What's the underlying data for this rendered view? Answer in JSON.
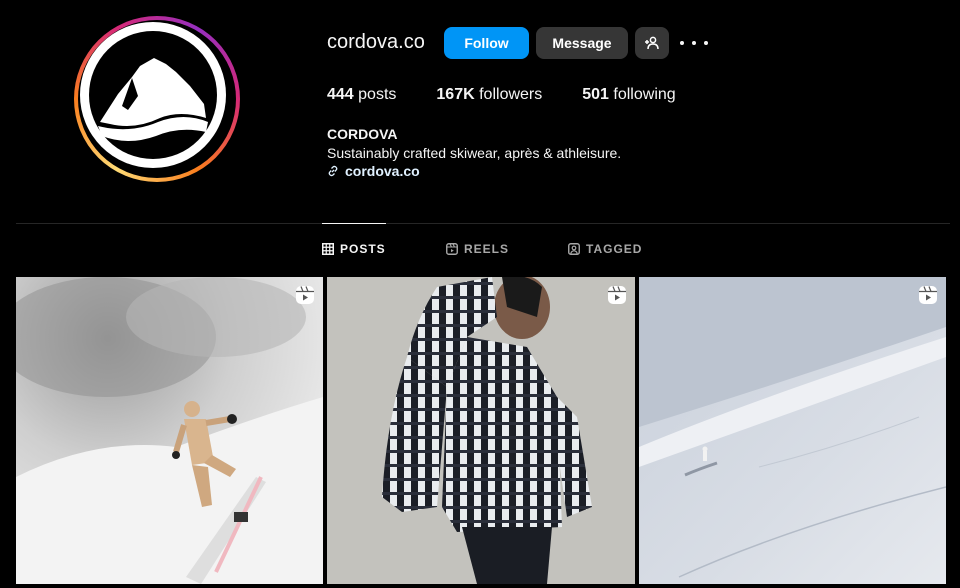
{
  "profile": {
    "username": "cordova.co",
    "follow_label": "Follow",
    "message_label": "Message",
    "stats": {
      "posts_count": "444",
      "posts_label": "posts",
      "followers_count": "167K",
      "followers_label": "followers",
      "following_count": "501",
      "following_label": "following"
    },
    "bio": {
      "name": "CORDOVA",
      "text": "Sustainably crafted skiwear, après & athleisure.",
      "link": "cordova.co"
    }
  },
  "tabs": [
    {
      "label": "POSTS",
      "icon": "grid-icon",
      "active": true
    },
    {
      "label": "REELS",
      "icon": "reels-icon",
      "active": false
    },
    {
      "label": "TAGGED",
      "icon": "tagged-icon",
      "active": false
    }
  ],
  "posts": [
    {
      "type": "reel",
      "subject": "snowboarder"
    },
    {
      "type": "reel",
      "subject": "puffer-jacket-model"
    },
    {
      "type": "reel",
      "subject": "skier-on-slope"
    }
  ],
  "colors": {
    "accent": "#0095f6",
    "button_secondary": "#363636",
    "background": "#000000",
    "link": "#e0f1ff"
  }
}
